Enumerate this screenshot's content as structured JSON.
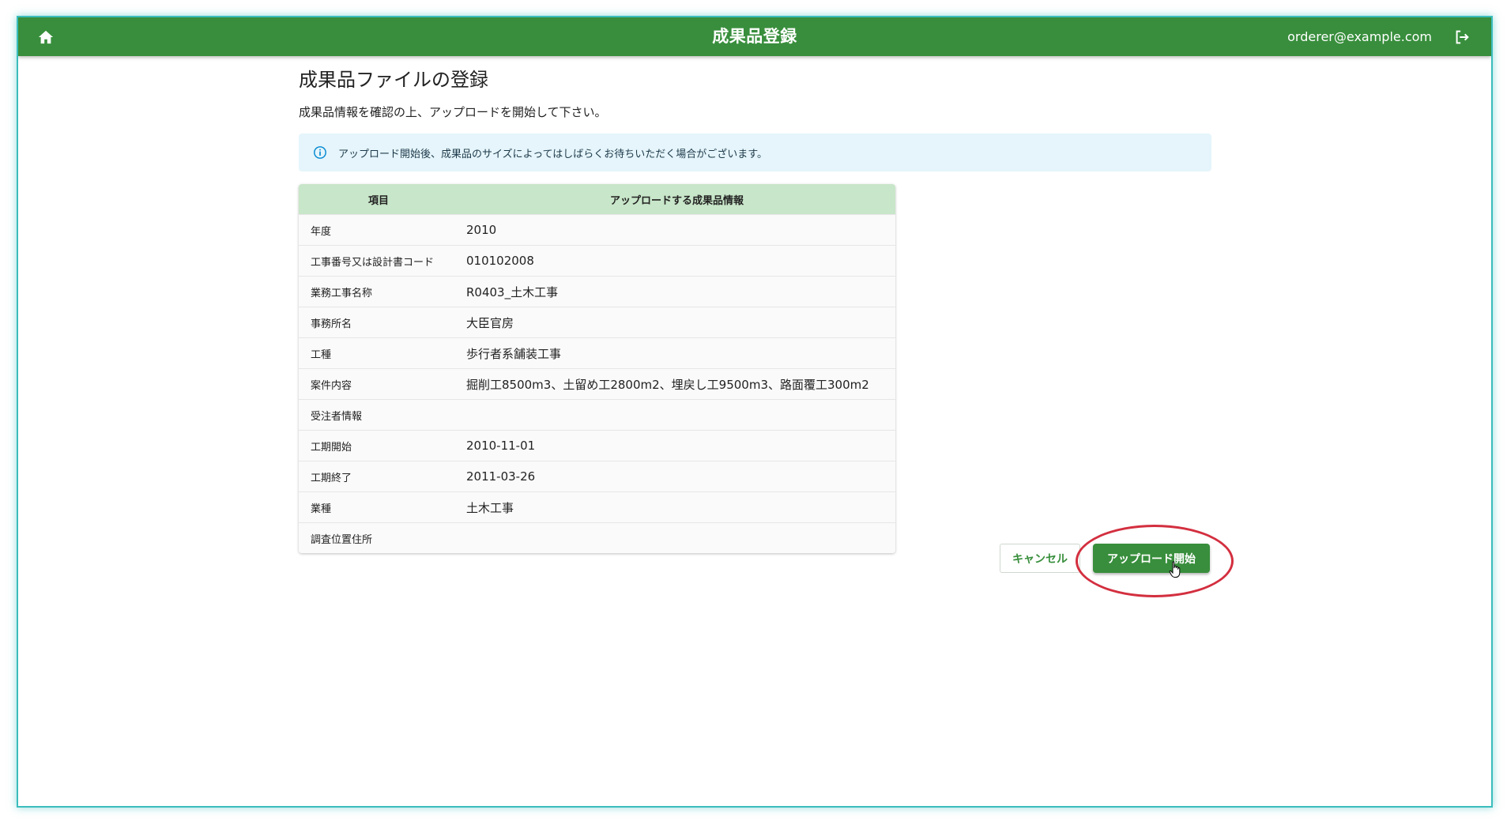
{
  "appbar": {
    "title": "成果品登録",
    "user_email": "orderer@example.com"
  },
  "page": {
    "title": "成果品ファイルの登録",
    "description": "成果品情報を確認の上、アップロードを開始して下さい。",
    "info_message": "アップロード開始後、成果品のサイズによってはしばらくお待ちいただく場合がございます。"
  },
  "table": {
    "headers": [
      "項目",
      "アップロードする成果品情報"
    ],
    "rows": [
      {
        "label": "年度",
        "value": "2010"
      },
      {
        "label": "工事番号又は設計書コード",
        "value": "010102008"
      },
      {
        "label": "業務工事名称",
        "value": "R0403_土木工事"
      },
      {
        "label": "事務所名",
        "value": "大臣官房"
      },
      {
        "label": "工種",
        "value": "歩行者系舗装工事"
      },
      {
        "label": "案件内容",
        "value": "掘削工8500m3、土留め工2800m2、埋戻し工9500m3、路面覆工300m2"
      },
      {
        "label": "受注者情報",
        "value": ""
      },
      {
        "label": "工期開始",
        "value": "2010-11-01"
      },
      {
        "label": "工期終了",
        "value": "2011-03-26"
      },
      {
        "label": "業種",
        "value": "土木工事"
      },
      {
        "label": "調査位置住所",
        "value": ""
      }
    ]
  },
  "actions": {
    "cancel_label": "キャンセル",
    "upload_label": "アップロード開始"
  },
  "colors": {
    "primary": "#388e3c",
    "table_header": "#c8e6c9",
    "info_bg": "#e5f5fb",
    "highlight": "#d32f3f"
  }
}
